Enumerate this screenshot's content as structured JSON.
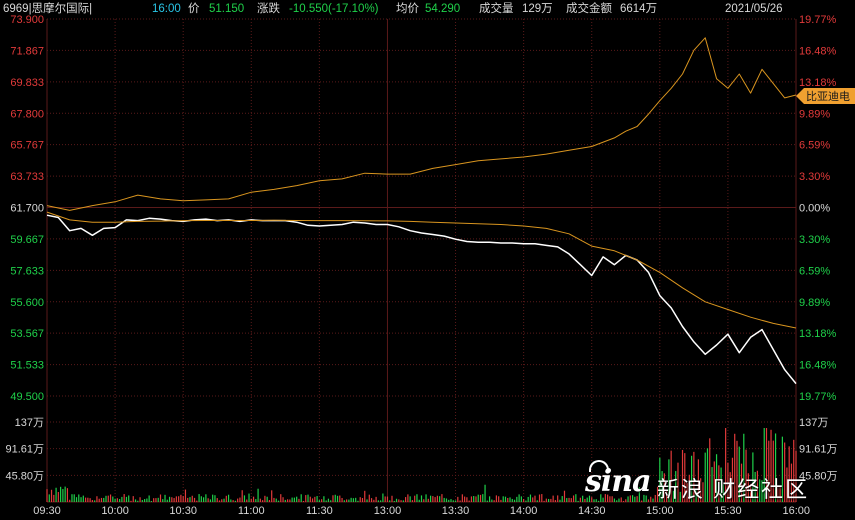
{
  "header": {
    "code_name": "6969|思摩尔国际|",
    "time": "16:00",
    "price_label": "价",
    "price": "51.150",
    "change_label": "涨跌",
    "change": "-10.550(-17.10%)",
    "avg_label": "均价",
    "avg": "54.290",
    "volume_label": "成交量",
    "volume": "129万",
    "amount_label": "成交金额",
    "amount": "6614万",
    "date": "2021/05/26"
  },
  "colors": {
    "up_red": "#e23a3a",
    "down_green": "#1fd14a",
    "price_line": "#ffffff",
    "avg_line": "#d9951f",
    "compare_line": "#d9951f",
    "grid": "#5a1a1a",
    "axis_text": "#d8d8d8",
    "tag_bg": "#f0a030"
  },
  "compare_tag": "比亚迪电",
  "watermark": {
    "logo": "sina",
    "text": "新浪 财经社区"
  },
  "chart_data": {
    "type": "line",
    "title": "",
    "x_ticks": [
      "09:30",
      "10:00",
      "10:30",
      "11:00",
      "11:30",
      "13:00",
      "13:30",
      "14:00",
      "14:30",
      "15:00",
      "15:30",
      "16:00"
    ],
    "y_left_ticks": [
      "73.900",
      "71.867",
      "69.833",
      "67.800",
      "65.767",
      "63.733",
      "61.700",
      "59.667",
      "57.633",
      "55.600",
      "53.567",
      "51.533",
      "49.500"
    ],
    "y_right_ticks": [
      "19.77%",
      "16.48%",
      "13.18%",
      "9.89%",
      "6.59%",
      "3.30%",
      "0.00%",
      "3.30%",
      "6.59%",
      "9.89%",
      "13.18%",
      "16.48%",
      "19.77%"
    ],
    "ylim": [
      49.5,
      73.9
    ],
    "prev_close": 61.7,
    "grid": true,
    "series": [
      {
        "name": "6969|思摩尔国际|",
        "color": "#ffffff",
        "x": [
          0,
          5,
          10,
          15,
          20,
          25,
          30,
          35,
          40,
          45,
          50,
          55,
          60,
          65,
          70,
          75,
          80,
          85,
          90,
          95,
          100,
          105,
          110,
          115,
          120,
          125,
          130,
          135,
          140,
          145,
          150,
          155,
          160,
          165,
          170,
          175,
          180,
          185,
          190,
          195,
          200,
          205,
          210,
          215,
          220,
          225,
          230,
          235,
          240,
          245,
          250,
          255,
          260,
          265,
          270,
          275,
          280,
          285,
          290,
          295,
          300,
          305,
          310,
          315,
          320,
          325,
          330
        ],
        "values": [
          61.2,
          61.05,
          60.2,
          60.35,
          59.9,
          60.35,
          60.4,
          60.9,
          60.85,
          61.0,
          60.95,
          60.85,
          60.8,
          60.9,
          60.95,
          60.85,
          60.9,
          60.8,
          60.9,
          60.85,
          60.85,
          60.85,
          60.75,
          60.55,
          60.5,
          60.55,
          60.6,
          60.75,
          60.7,
          60.6,
          60.6,
          60.45,
          60.2,
          60.05,
          59.95,
          59.85,
          59.65,
          59.5,
          59.45,
          59.45,
          59.4,
          59.4,
          59.35,
          59.35,
          59.25,
          59.15,
          58.7,
          58.0,
          57.3,
          58.5,
          58.0,
          58.6,
          58.3,
          57.5,
          56.0,
          55.2,
          54.0,
          53.0,
          52.2,
          52.8,
          53.5,
          52.3,
          53.3,
          53.8,
          52.5,
          51.2,
          50.3
        ]
      },
      {
        "name": "均价",
        "color": "#d9951f",
        "x": [
          0,
          10,
          20,
          30,
          40,
          50,
          60,
          70,
          80,
          90,
          100,
          110,
          120,
          130,
          140,
          150,
          160,
          170,
          180,
          190,
          200,
          210,
          220,
          230,
          240,
          250,
          260,
          270,
          280,
          290,
          300,
          310,
          320,
          330
        ],
        "values": [
          61.4,
          60.9,
          60.75,
          60.75,
          60.8,
          60.82,
          60.85,
          60.86,
          60.86,
          60.86,
          60.87,
          60.86,
          60.85,
          60.85,
          60.84,
          60.83,
          60.8,
          60.75,
          60.7,
          60.65,
          60.6,
          60.5,
          60.35,
          60.0,
          59.2,
          58.9,
          58.3,
          57.5,
          56.5,
          55.6,
          55.1,
          54.6,
          54.2,
          53.9
        ]
      },
      {
        "name": "比亚迪电",
        "color": "#d9951f",
        "x": [
          0,
          10,
          20,
          30,
          40,
          50,
          60,
          70,
          80,
          90,
          100,
          110,
          120,
          130,
          140,
          150,
          160,
          170,
          180,
          190,
          200,
          210,
          220,
          230,
          240,
          250,
          255,
          260,
          265,
          270,
          275,
          280,
          285,
          290,
          295,
          300,
          305,
          310,
          315,
          320,
          325,
          330
        ],
        "values": [
          0.2,
          -0.3,
          0.2,
          0.6,
          1.3,
          0.9,
          0.7,
          0.8,
          0.9,
          1.6,
          1.9,
          2.3,
          2.8,
          3.0,
          3.6,
          3.5,
          3.5,
          4.1,
          4.5,
          4.9,
          5.1,
          5.3,
          5.6,
          6.0,
          6.4,
          7.3,
          8.0,
          8.5,
          9.8,
          11.2,
          12.5,
          14.0,
          16.5,
          17.8,
          13.5,
          12.5,
          14.0,
          12.0,
          14.5,
          13.0,
          11.5,
          11.8
        ]
      }
    ],
    "volume": {
      "ticks": [
        "137万",
        "91.61万",
        "45.80万"
      ],
      "ylim": [
        0,
        137
      ]
    }
  }
}
